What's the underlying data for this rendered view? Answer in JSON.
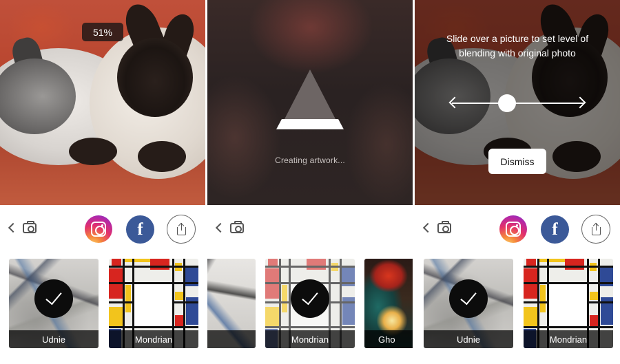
{
  "colors": {
    "facebook_blue": "#3b5998",
    "instagram_gradient": [
      "#fdd66b",
      "#f5883b",
      "#e2306c",
      "#b328a8",
      "#6a3bd3"
    ],
    "label_bar": "#000000",
    "check_badge": "#0c0c0c"
  },
  "panel1": {
    "progress_badge": "51%",
    "progress_value": 51,
    "toolbar": {
      "back_icon": "chevron-left-icon",
      "camera_icon": "camera-icon",
      "instagram_icon": "instagram-icon",
      "facebook_glyph": "f",
      "share_icon": "share-icon"
    },
    "styles": [
      {
        "label": "Udnie",
        "selected": true
      },
      {
        "label": "Mondrian",
        "selected": false
      }
    ]
  },
  "panel2": {
    "loading_text": "Creating artwork...",
    "toolbar": {
      "back_icon": "chevron-left-icon",
      "camera_icon": "camera-icon"
    },
    "styles": [
      {
        "label": "dnie",
        "selected": false
      },
      {
        "label": "Mondrian",
        "selected": true
      },
      {
        "label": "Gho",
        "selected": false
      }
    ]
  },
  "panel3": {
    "hint_text": "Slide over a picture to set level of blending with original photo",
    "dismiss_label": "Dismiss",
    "toolbar": {
      "back_icon": "chevron-left-icon",
      "camera_icon": "camera-icon",
      "instagram_icon": "instagram-icon",
      "facebook_glyph": "f",
      "share_icon": "share-icon"
    },
    "styles": [
      {
        "label": "Udnie",
        "selected": true
      },
      {
        "label": "Mondrian",
        "selected": false
      }
    ]
  }
}
